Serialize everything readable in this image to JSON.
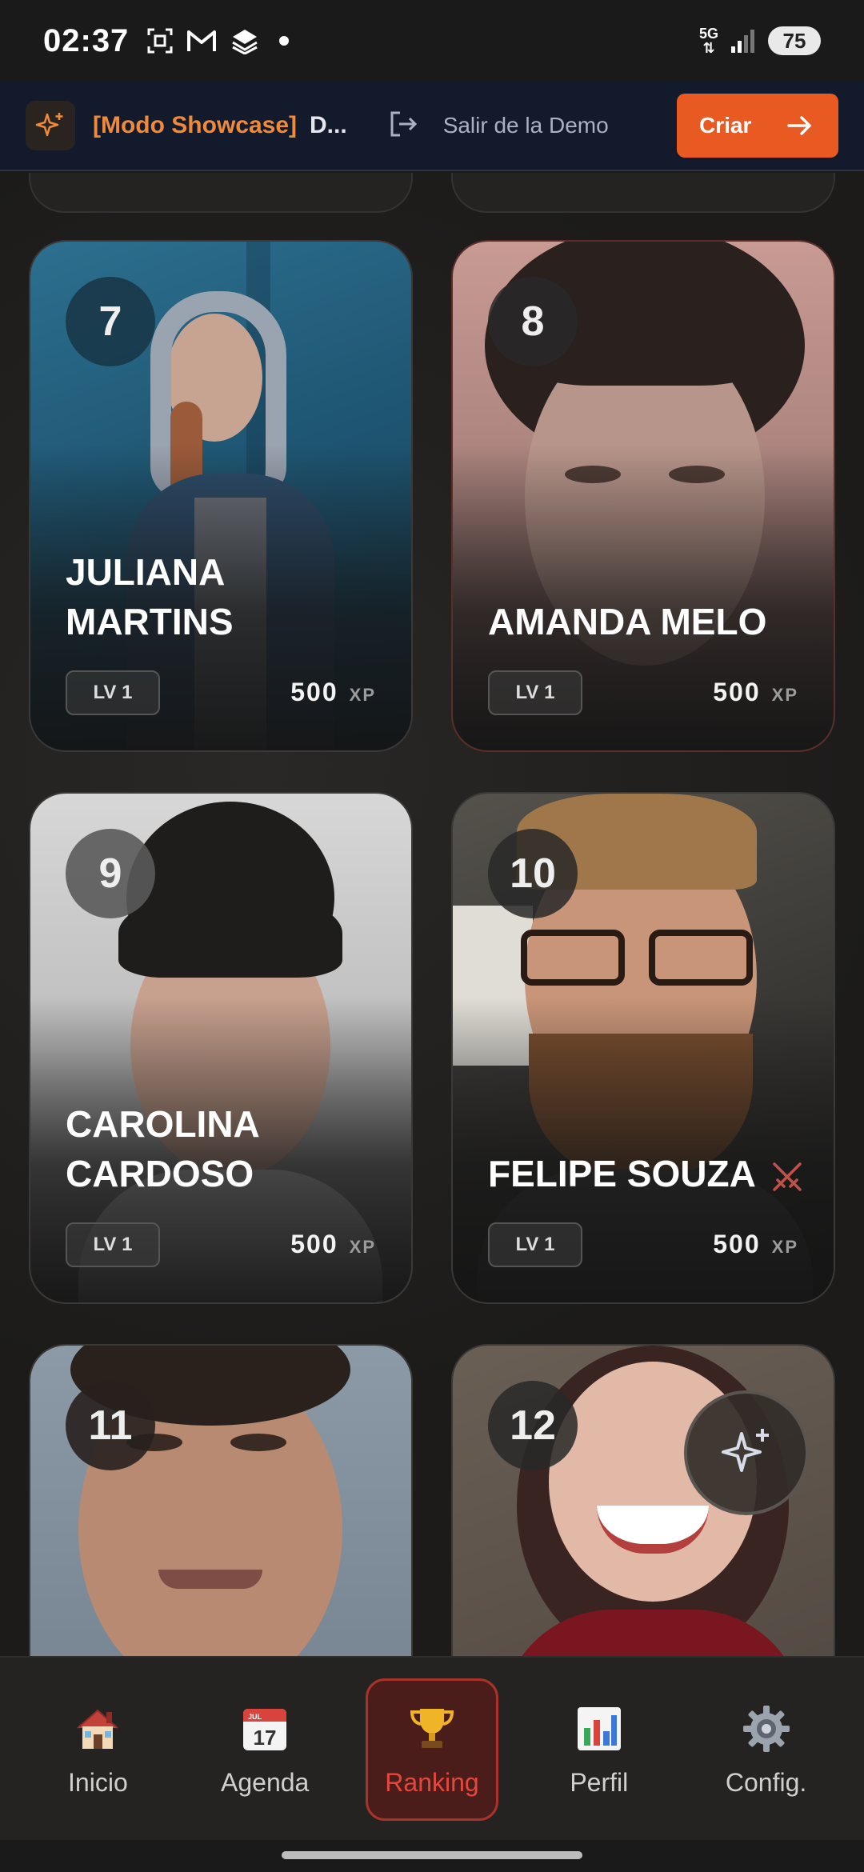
{
  "status_bar": {
    "time": "02:37",
    "network": "5G",
    "battery": "75",
    "icons": [
      "screenshot-icon",
      "gmail-icon",
      "stack-icon",
      "notification-dot",
      "signal-icon"
    ]
  },
  "banner": {
    "mode_label": "[Modo Showcase]",
    "demo_label": "D...",
    "exit_label": "Salir de la Demo",
    "create_label": "Criar",
    "accent_color": "#e85a22"
  },
  "cards": [
    {
      "rank": "7",
      "name": "Juliana Martins",
      "level": "LV 1",
      "xp": "500",
      "xp_unit": "XP"
    },
    {
      "rank": "8",
      "name": "Amanda Melo",
      "level": "LV 1",
      "xp": "500",
      "xp_unit": "XP"
    },
    {
      "rank": "9",
      "name": "Carolina Cardoso",
      "level": "LV 1",
      "xp": "500",
      "xp_unit": "XP"
    },
    {
      "rank": "10",
      "name": "Felipe Souza",
      "level": "LV 1",
      "xp": "500",
      "xp_unit": "XP",
      "badge_icon": "swords-icon"
    },
    {
      "rank": "11"
    },
    {
      "rank": "12"
    }
  ],
  "nav": {
    "items": [
      {
        "label": "Inicio",
        "icon": "home-icon"
      },
      {
        "label": "Agenda",
        "icon": "calendar-icon",
        "calendar_month": "JUL",
        "calendar_day": "17"
      },
      {
        "label": "Ranking",
        "icon": "trophy-icon",
        "active": true
      },
      {
        "label": "Perfil",
        "icon": "bar-chart-icon"
      },
      {
        "label": "Config.",
        "icon": "gear-icon"
      }
    ]
  }
}
